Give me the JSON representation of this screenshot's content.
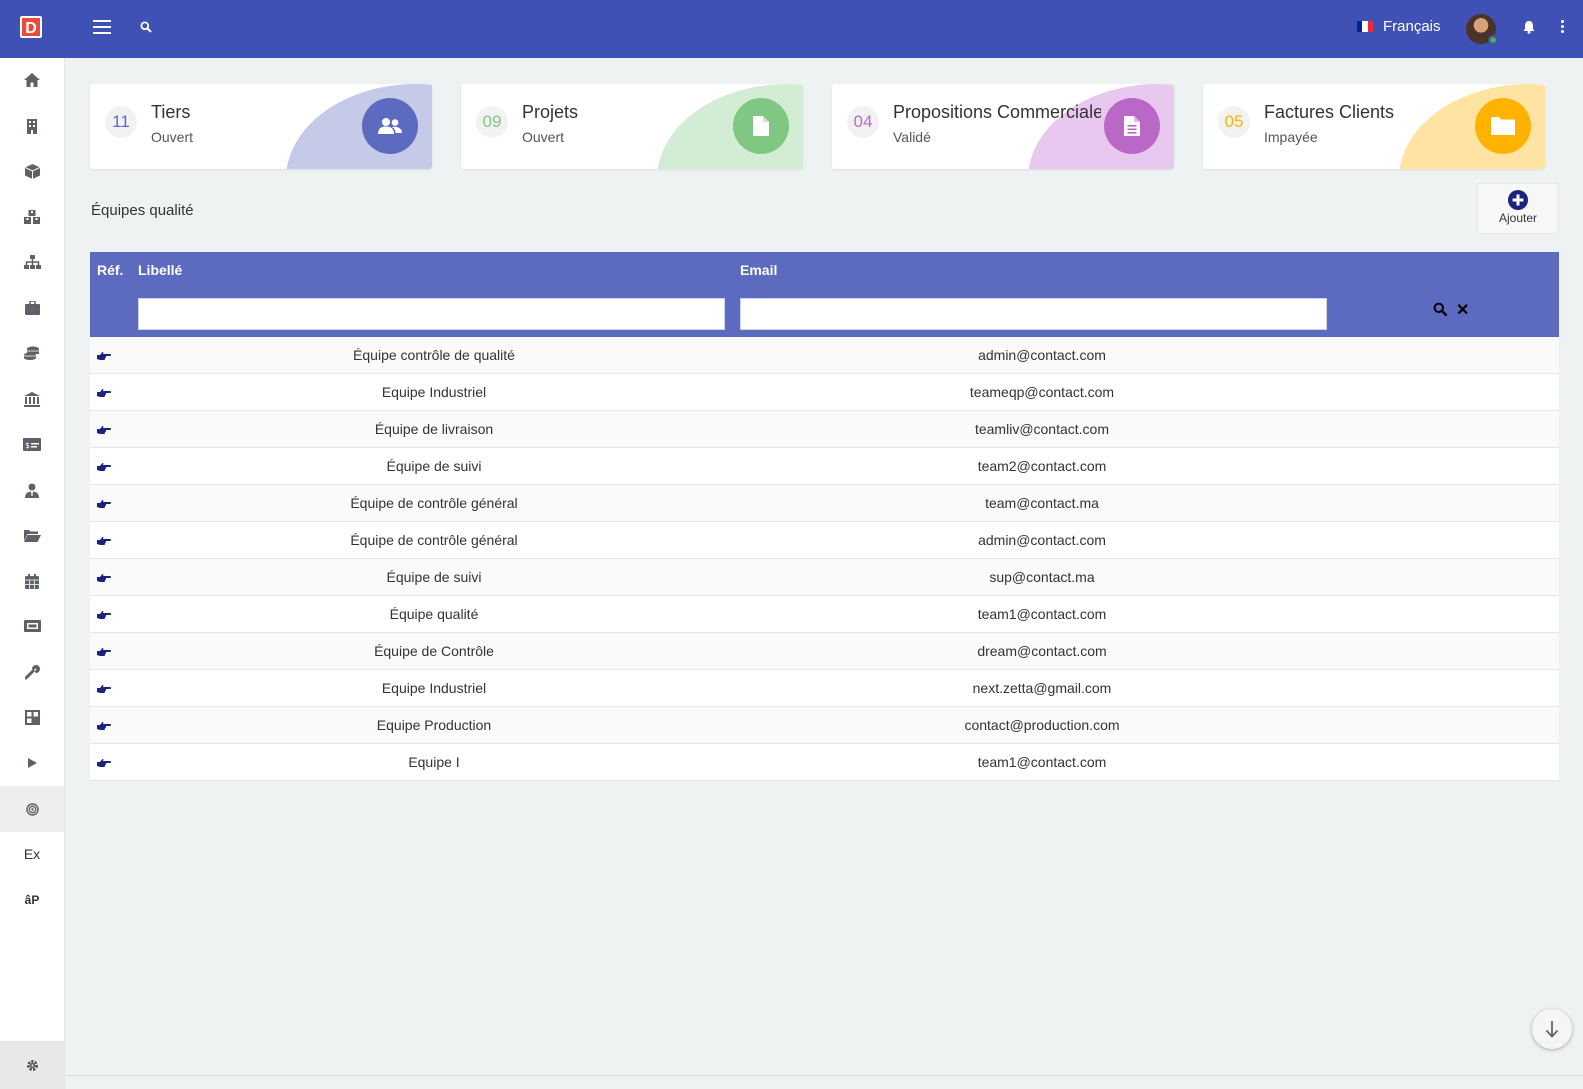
{
  "app": {
    "logo_letter": "D"
  },
  "header": {
    "language_label": "Français",
    "flag_colors": [
      "#002395",
      "#ffffff",
      "#ed2939"
    ]
  },
  "sidebar": {
    "items": [
      {
        "icon": "home-icon"
      },
      {
        "icon": "building-icon"
      },
      {
        "icon": "box-icon"
      },
      {
        "icon": "boxes-icon"
      },
      {
        "icon": "sitemap-icon"
      },
      {
        "icon": "briefcase-icon"
      },
      {
        "icon": "coins-icon"
      },
      {
        "icon": "bank-icon"
      },
      {
        "icon": "money-check-icon"
      },
      {
        "icon": "user-tie-icon"
      },
      {
        "icon": "folder-open-icon"
      },
      {
        "icon": "calendar-icon"
      },
      {
        "icon": "ticket-icon"
      },
      {
        "icon": "wrench-icon"
      },
      {
        "icon": "grid-icon"
      },
      {
        "icon": "play-icon"
      },
      {
        "icon": "target-icon"
      }
    ],
    "text_items": [
      "Ex",
      "âP"
    ],
    "bottom_icon": "settings-icon"
  },
  "cards": [
    {
      "count": "11",
      "title": "Tiers",
      "subtitle": "Ouvert",
      "color": "#5c6bc0",
      "blob": "#c5cae9",
      "icon": "users-icon"
    },
    {
      "count": "09",
      "title": "Projets",
      "subtitle": "Ouvert",
      "color": "#81c784",
      "blob": "#d3edd4",
      "icon": "file-icon"
    },
    {
      "count": "04",
      "title": "Propositions Commerciales",
      "subtitle": "Validé",
      "color": "#ba68c8",
      "blob": "#e9c8ef",
      "icon": "file-text-icon"
    },
    {
      "count": "05",
      "title": "Factures Clients",
      "subtitle": "Impayée",
      "color": "#ffb300",
      "blob": "#ffe3a3",
      "icon": "folder-icon"
    }
  ],
  "page": {
    "title": "Équipes qualité",
    "add_label": "Ajouter"
  },
  "table": {
    "headers": {
      "ref": "Réf.",
      "libelle": "Libellé",
      "email": "Email"
    },
    "filters": {
      "libelle": "",
      "email": ""
    },
    "rows": [
      {
        "libelle": "Équipe contrôle de qualité",
        "email": "admin@contact.com"
      },
      {
        "libelle": "Equipe Industriel",
        "email": "teameqp@contact.com"
      },
      {
        "libelle": "Équipe de livraison",
        "email": "teamliv@contact.com"
      },
      {
        "libelle": "Équipe de suivi",
        "email": "team2@contact.com"
      },
      {
        "libelle": "Équipe de contrôle général",
        "email": "team@contact.ma"
      },
      {
        "libelle": "Équipe de contrôle général",
        "email": "admin@contact.com"
      },
      {
        "libelle": "Équipe de suivi",
        "email": "sup@contact.ma"
      },
      {
        "libelle": "Équipe qualité",
        "email": "team1@contact.com"
      },
      {
        "libelle": "Équipe de Contrôle",
        "email": "dream@contact.com"
      },
      {
        "libelle": "Equipe Industriel",
        "email": "next.zetta@gmail.com"
      },
      {
        "libelle": "Equipe Production",
        "email": "contact@production.com"
      },
      {
        "libelle": "Equipe I",
        "email": "team1@contact.com"
      }
    ]
  }
}
